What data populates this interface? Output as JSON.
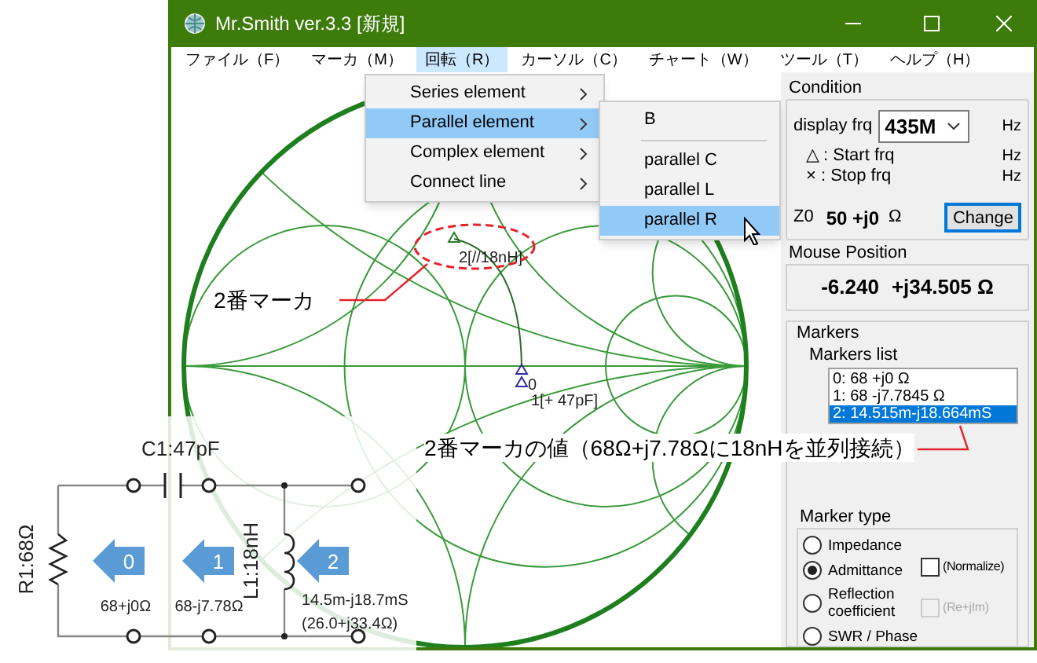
{
  "window": {
    "title": "Mr.Smith ver.3.3 [新規]"
  },
  "menu_bar": [
    {
      "label": "ファイル（F）",
      "selected": false
    },
    {
      "label": "マーカ（M）",
      "selected": false
    },
    {
      "label": "回転（R）",
      "selected": true
    },
    {
      "label": "カーソル（C）",
      "selected": false
    },
    {
      "label": "チャート（W）",
      "selected": false
    },
    {
      "label": "ツール（T）",
      "selected": false
    },
    {
      "label": "ヘルプ（H）",
      "selected": false
    }
  ],
  "dropdown": {
    "items": [
      {
        "label": "Series element",
        "selected": false
      },
      {
        "label": "Parallel element",
        "selected": true
      },
      {
        "label": "Complex element",
        "selected": false
      },
      {
        "label": "Connect line",
        "selected": false
      }
    ]
  },
  "submenu": {
    "items": [
      {
        "kind": "item",
        "label": "B",
        "selected": false
      },
      {
        "kind": "separator"
      },
      {
        "kind": "item",
        "label": "parallel C",
        "selected": false
      },
      {
        "kind": "item",
        "label": "parallel L",
        "selected": false
      },
      {
        "kind": "item",
        "label": "parallel R",
        "selected": true
      }
    ]
  },
  "smith_chart": {
    "markers": [
      {
        "label": "2[//18nH]"
      },
      {
        "label": "0"
      },
      {
        "label": "1[+ 47pF]"
      }
    ]
  },
  "annotations": [
    {
      "text": "2番マーカ"
    },
    {
      "text": "2番マーカの値（68Ω+j7.78Ωに18nHを並列接続）"
    }
  ],
  "circuit": {
    "capacitor_label": "C1:47pF",
    "resistor_label": "R1:68Ω",
    "inductor_label": "L1:18nH",
    "ports": [
      {
        "number": "0",
        "value": "68+j0Ω"
      },
      {
        "number": "1",
        "value": "68-j7.78Ω"
      },
      {
        "number": "2",
        "value": "14.5m-j18.7mS",
        "value_2": "(26.0+j33.4Ω)"
      }
    ]
  },
  "condition": {
    "title": "Condition",
    "display_frq_label": "display frq",
    "display_frq": "435M",
    "unit": "Hz",
    "start_label": "△ : Start frq",
    "start_unit": "Hz",
    "stop_label": "× : Stop frq",
    "stop_unit": "Hz",
    "z0_label": "Z0",
    "z0_value": "50 +j0",
    "z0_unit": "Ω",
    "change_button": "Change"
  },
  "mouse_position": {
    "title": "Mouse Position",
    "real": "-6.240",
    "imag": "+j34.505 Ω"
  },
  "markers": {
    "title": "Markers",
    "list_label": "Markers list",
    "list": [
      {
        "label": "0: 68 +j0 Ω",
        "selected": false
      },
      {
        "label": "1: 68 -j7.7845 Ω",
        "selected": false
      },
      {
        "label": "2: 14.515m-j18.664mS",
        "selected": true
      }
    ],
    "marker_type": {
      "title": "Marker type",
      "options": [
        {
          "label": "Impedance",
          "selected": false
        },
        {
          "label": "Admittance",
          "selected": true
        },
        {
          "label": "Reflection coefficient",
          "selected": false
        },
        {
          "label": "SWR / Phase",
          "selected": false
        }
      ],
      "checkboxes": [
        {
          "label": "(Normalize)",
          "checked": false,
          "disabled": false
        },
        {
          "label": "(Re+jIm)",
          "checked": false,
          "disabled": true
        }
      ]
    }
  }
}
